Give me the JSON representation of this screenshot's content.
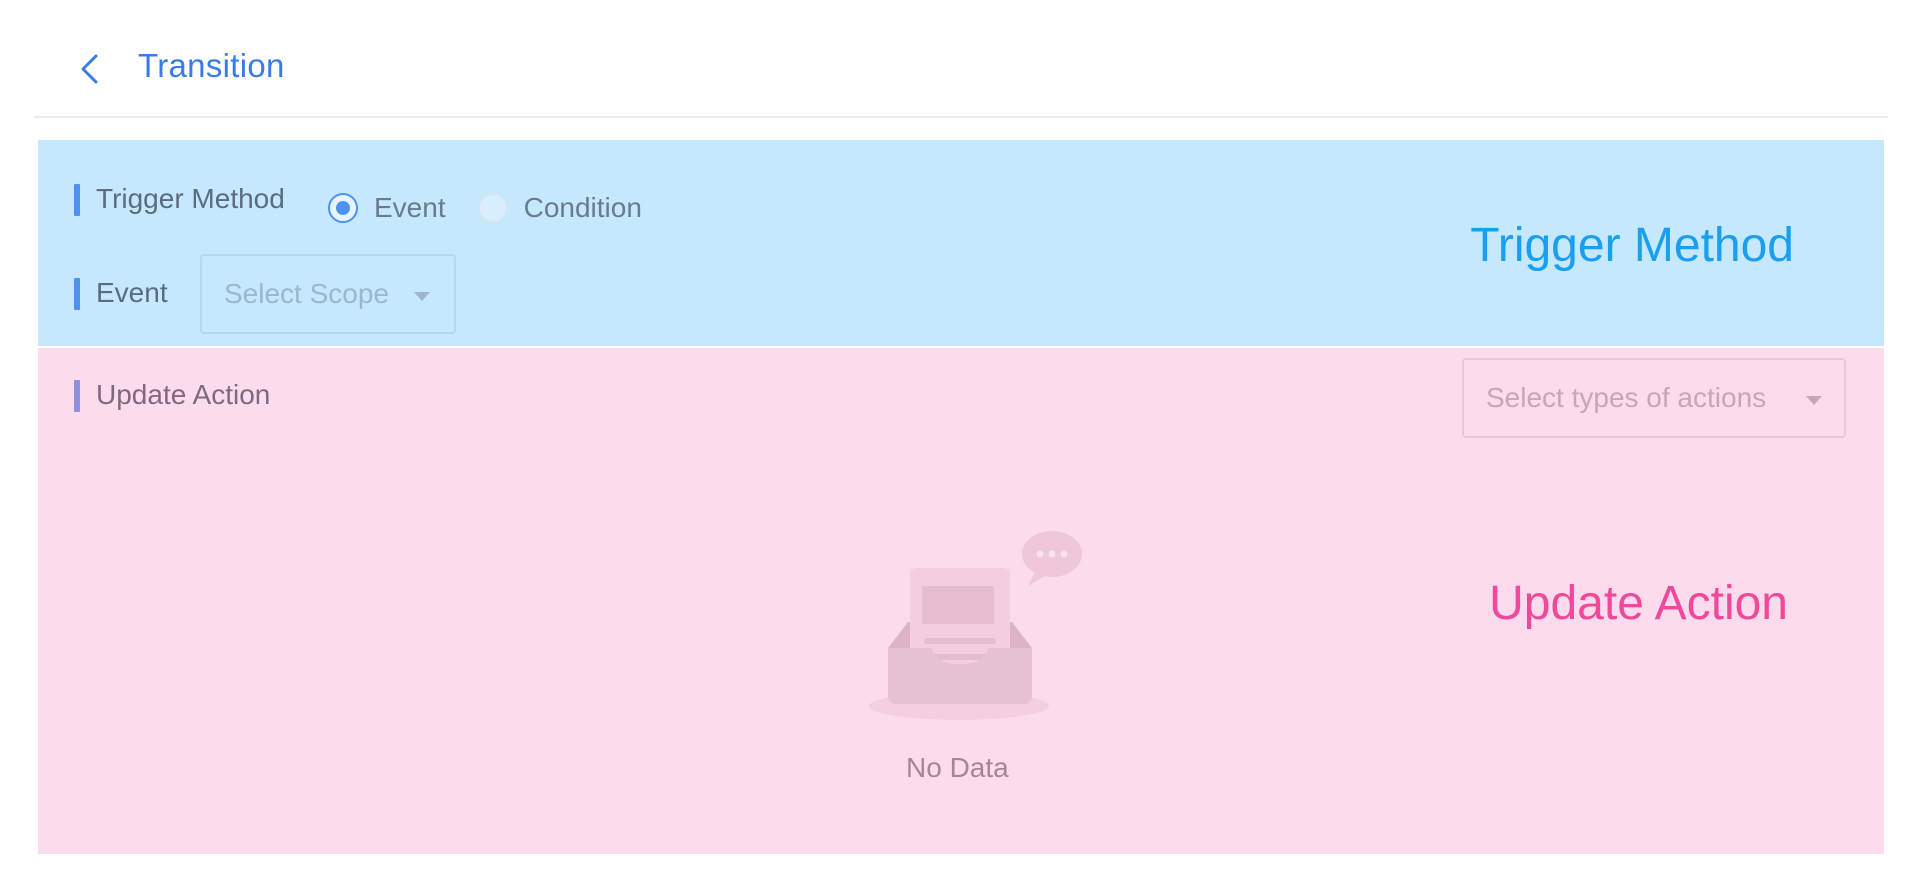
{
  "header": {
    "back_icon": "chevron-left-icon",
    "title": "Transition"
  },
  "trigger": {
    "method_label": "Trigger Method",
    "options": [
      {
        "label": "Event",
        "checked": true
      },
      {
        "label": "Condition",
        "checked": false
      }
    ],
    "event_label": "Event",
    "scope_placeholder": "Select Scope",
    "overlay_label": "Trigger Method"
  },
  "update": {
    "label": "Update Action",
    "actions_placeholder": "Select types of actions",
    "empty_text": "No Data",
    "empty_icon": "empty-inbox-icon",
    "overlay_label": "Update Action"
  },
  "colors": {
    "accent": "#3a7bea",
    "trigger_bg": "#c6e8fd",
    "update_bg": "#fcdcec",
    "trigger_overlay": "#1a9ef0",
    "update_overlay": "#f0489a"
  }
}
